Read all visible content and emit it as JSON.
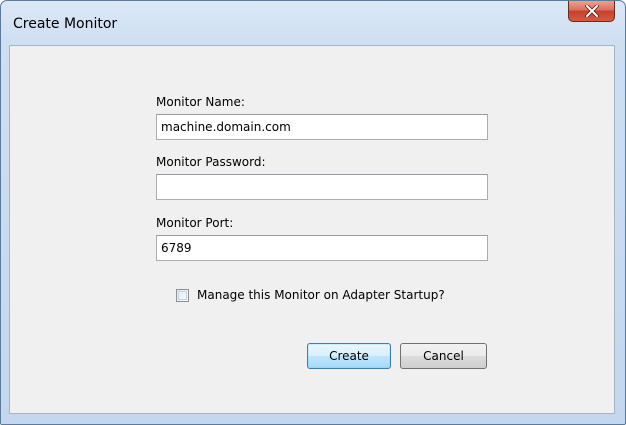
{
  "window": {
    "title": "Create Monitor"
  },
  "form": {
    "monitor_name": {
      "label": "Monitor Name:",
      "value": "machine.domain.com"
    },
    "monitor_password": {
      "label": "Monitor Password:",
      "value": ""
    },
    "monitor_port": {
      "label": "Monitor Port:",
      "value": "6789"
    },
    "manage_on_startup": {
      "label": "Manage this Monitor on Adapter Startup?",
      "checked": false
    }
  },
  "buttons": {
    "create_label": "Create",
    "cancel_label": "Cancel"
  },
  "icons": {
    "close": "close-icon"
  },
  "colors": {
    "close_button": "#c7412a",
    "default_button_border": "#3c7fb1"
  }
}
